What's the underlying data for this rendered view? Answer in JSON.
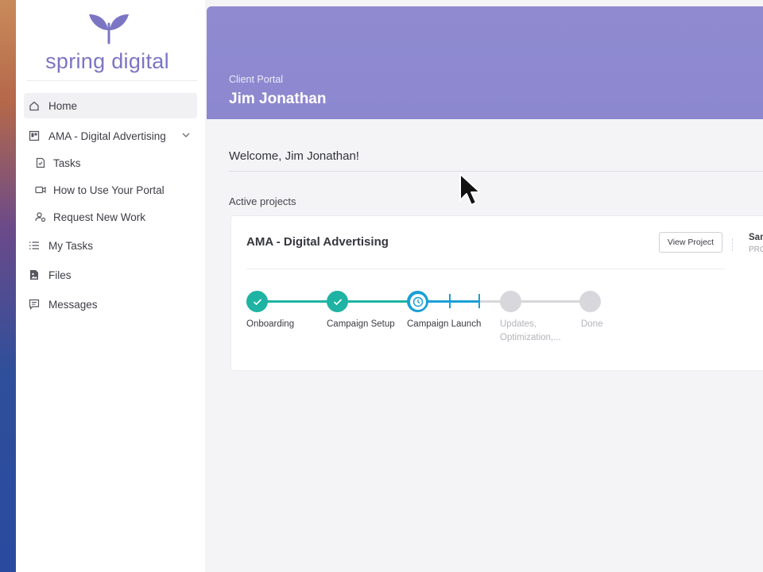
{
  "brand": {
    "name": "spring digital",
    "color": "#7b75c4"
  },
  "sidebar": {
    "items": [
      {
        "label": "Home",
        "icon": "home-icon",
        "active": true
      },
      {
        "label": "AMA - Digital Advertising",
        "icon": "project-icon",
        "expandable": true
      },
      {
        "label": "Tasks",
        "icon": "task-doc-icon",
        "sub": true
      },
      {
        "label": "How to Use Your Portal",
        "icon": "video-icon",
        "sub": true
      },
      {
        "label": "Request New Work",
        "icon": "person-gear-icon",
        "sub": true
      },
      {
        "label": "My Tasks",
        "icon": "list-icon"
      },
      {
        "label": "Files",
        "icon": "file-image-icon"
      },
      {
        "label": "Messages",
        "icon": "message-icon"
      }
    ]
  },
  "header": {
    "subtitle": "Client Portal",
    "title": "Jim Jonathan",
    "color": "#8f8ad0"
  },
  "main": {
    "welcome": "Welcome, Jim Jonathan!",
    "section_label": "Active projects"
  },
  "project": {
    "title": "AMA - Digital Advertising",
    "view_button": "View Project",
    "owner_name": "Sam",
    "owner_role": "PRO",
    "steps": [
      {
        "label": "Onboarding",
        "status": "done"
      },
      {
        "label": "Campaign Setup",
        "status": "done"
      },
      {
        "label": "Campaign Launch",
        "status": "current"
      },
      {
        "label": "Updates, Optimization,...",
        "status": "todo"
      },
      {
        "label": "Done",
        "status": "todo"
      }
    ],
    "colors": {
      "done": "#1fb3a3",
      "current": "#1a9fd6",
      "todo": "#d7d7dc"
    }
  }
}
